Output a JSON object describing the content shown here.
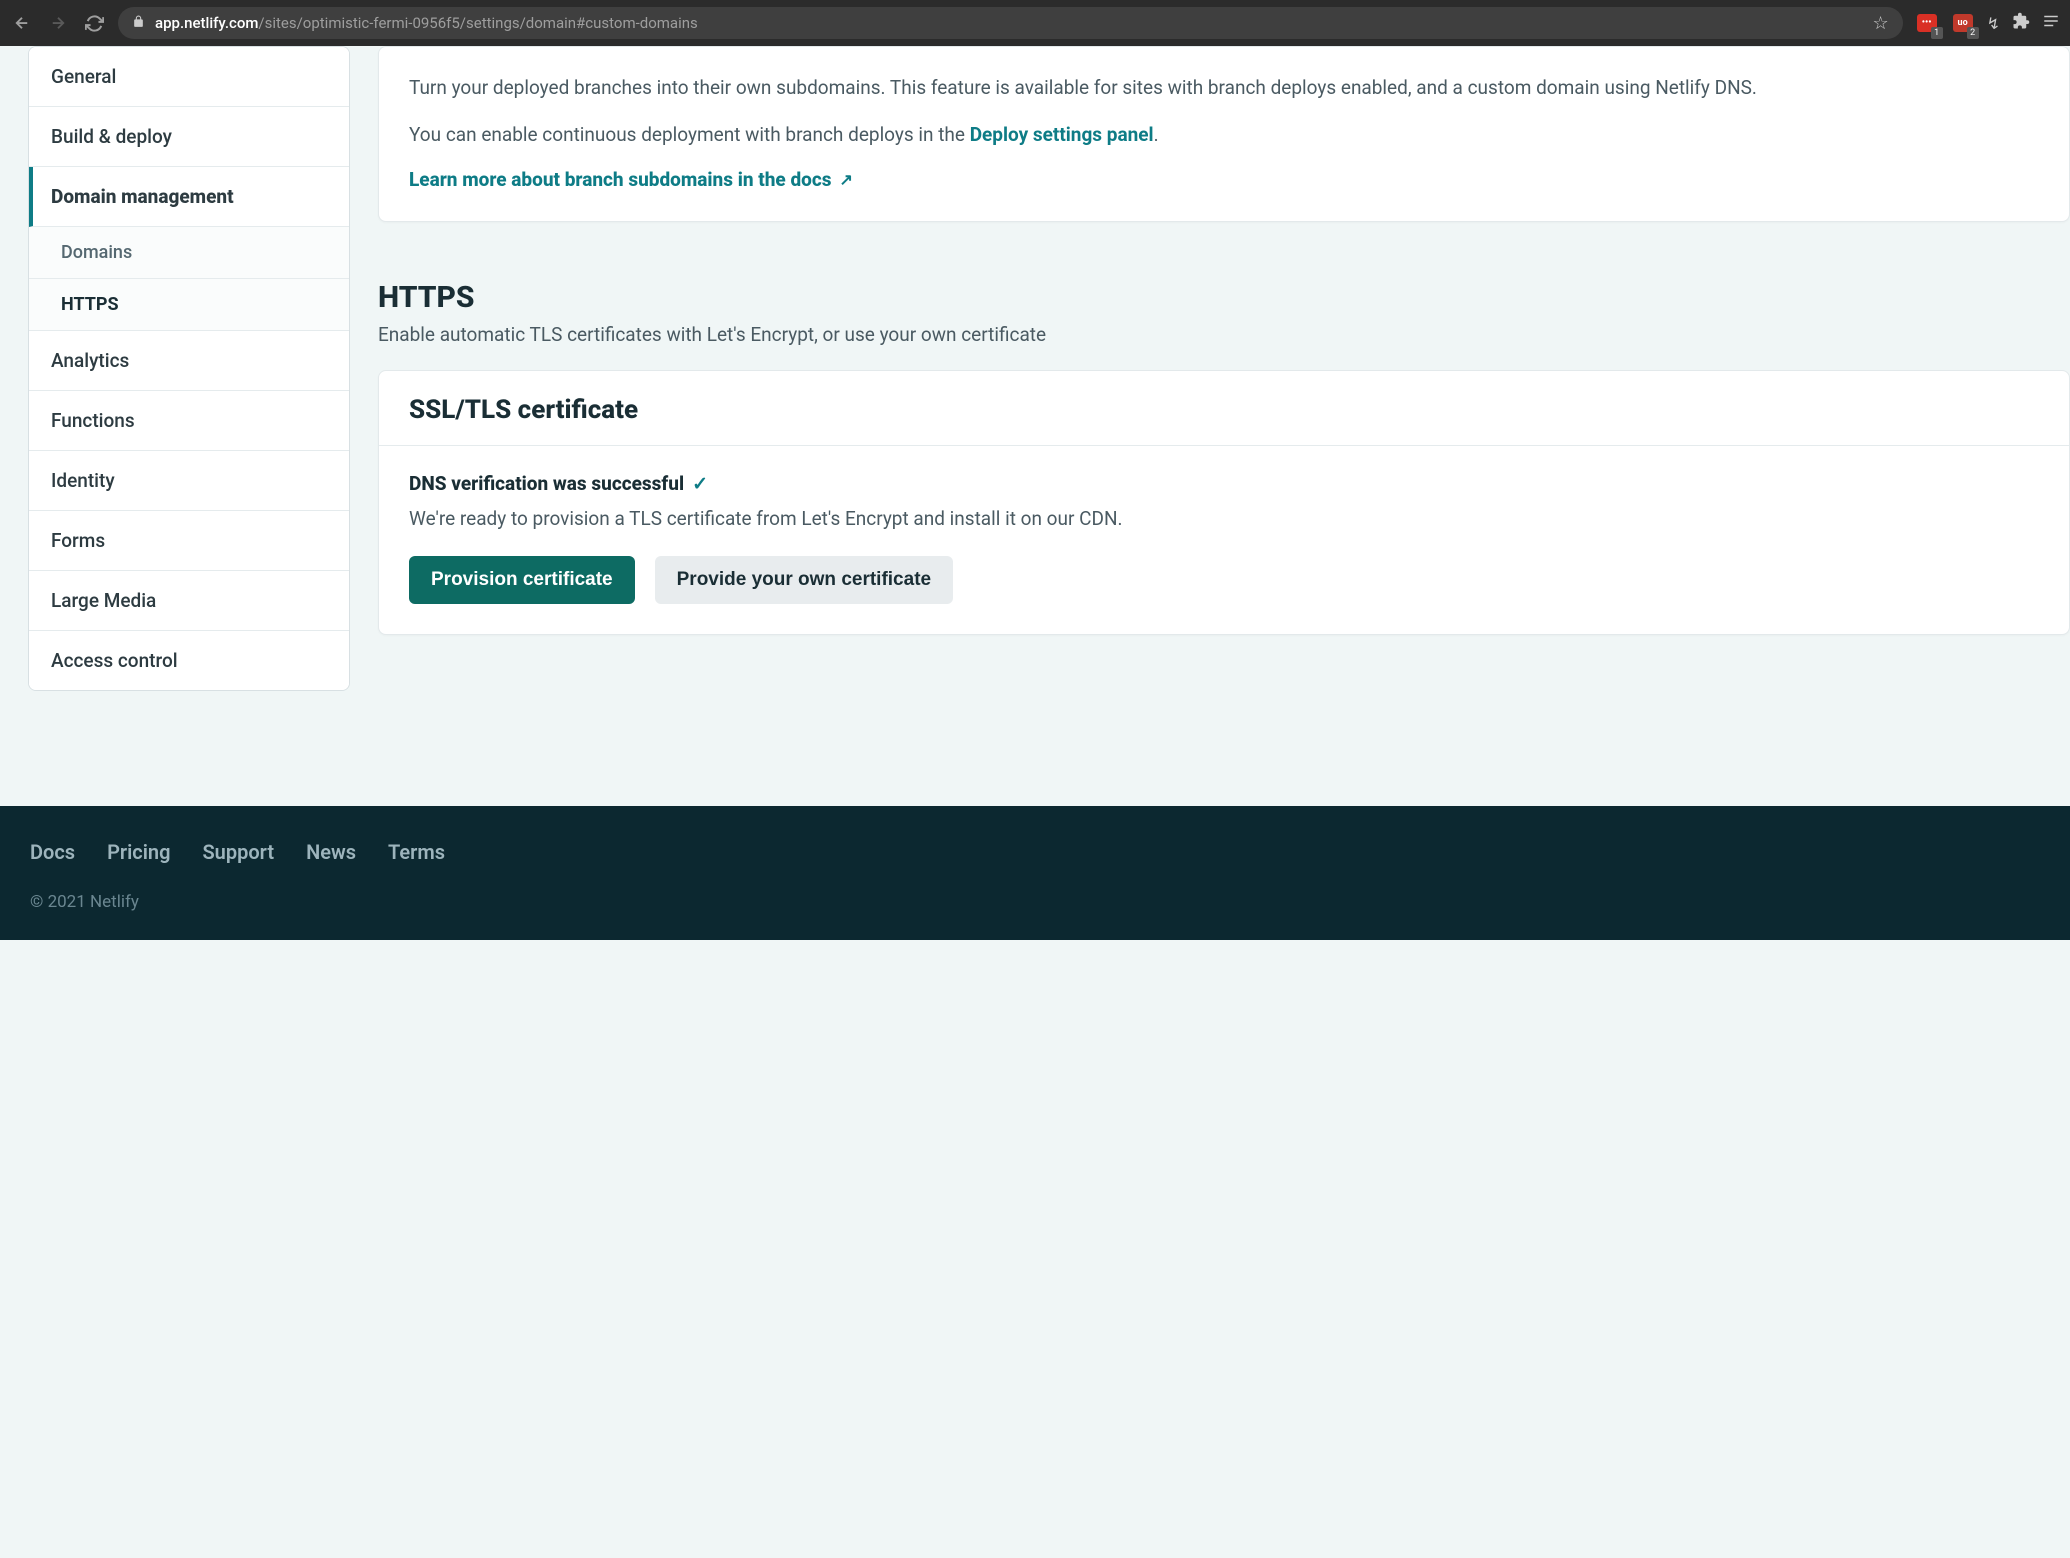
{
  "browser": {
    "url_host": "app.netlify.com",
    "url_path": "/sites/optimistic-fermi-0956f5/settings/domain#custom-domains",
    "ext_badges": [
      {
        "label": "•••",
        "count": "1"
      },
      {
        "label": "uo",
        "count": "2"
      }
    ]
  },
  "sidebar": {
    "items": [
      {
        "label": "General",
        "active": false
      },
      {
        "label": "Build & deploy",
        "active": false
      },
      {
        "label": "Domain management",
        "active": true
      },
      {
        "label": "Analytics",
        "active": false
      },
      {
        "label": "Functions",
        "active": false
      },
      {
        "label": "Identity",
        "active": false
      },
      {
        "label": "Forms",
        "active": false
      },
      {
        "label": "Large Media",
        "active": false
      },
      {
        "label": "Access control",
        "active": false
      }
    ],
    "subitems": [
      {
        "label": "Domains",
        "active": false
      },
      {
        "label": "HTTPS",
        "active": true
      }
    ]
  },
  "branch_card": {
    "para1": "Turn your deployed branches into their own subdomains. This feature is available for sites with branch deploys enabled, and a custom domain using Netlify DNS.",
    "para2_prefix": "You can enable continuous deployment with branch deploys in the ",
    "para2_link": "Deploy settings panel",
    "para2_suffix": ".",
    "doc_link": "Learn more about branch subdomains in the docs"
  },
  "https_section": {
    "title": "HTTPS",
    "subtitle": "Enable automatic TLS certificates with Let's Encrypt, or use your own certificate"
  },
  "ssl_card": {
    "heading": "SSL/TLS certificate",
    "verify_text": "DNS verification was successful",
    "verify_desc": "We're ready to provision a TLS certificate from Let's Encrypt and install it on our CDN.",
    "btn_primary": "Provision certificate",
    "btn_secondary": "Provide your own certificate"
  },
  "footer": {
    "links": [
      "Docs",
      "Pricing",
      "Support",
      "News",
      "Terms"
    ],
    "copyright": "© 2021 Netlify"
  }
}
